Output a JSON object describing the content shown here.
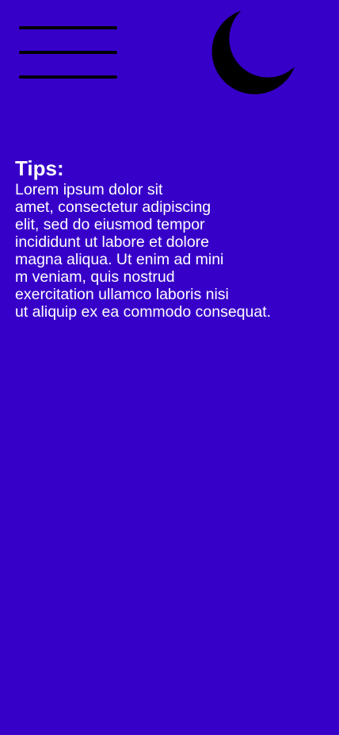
{
  "header": {
    "menu_icon": "hamburger-menu-icon",
    "theme_icon": "crescent-moon-icon",
    "theme_icon_color": "#000000"
  },
  "tips": {
    "title": "Tips:",
    "lines": [
      "Lorem ipsum dolor sit",
      "amet, consectetur adipiscing",
      "elit, sed do eiusmod tempor",
      "incididunt ut labore et dolore",
      "magna aliqua. Ut enim ad mini",
      "m veniam, quis nostrud",
      "exercitation ullamco laboris nisi",
      "ut aliquip ex ea commodo consequat."
    ]
  },
  "colors": {
    "background": "#3700c9",
    "text": "#ffffff",
    "icons": "#000000"
  }
}
